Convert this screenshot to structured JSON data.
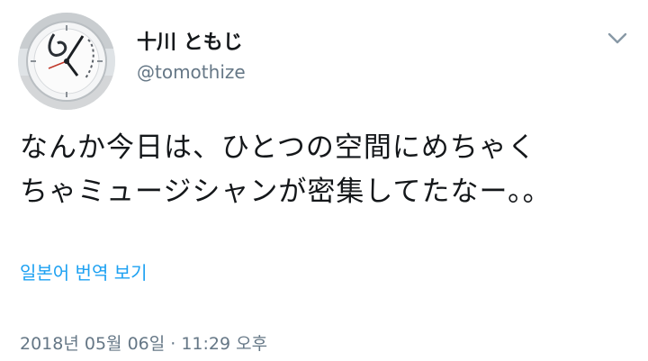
{
  "author": {
    "display_name": "十川 ともじ",
    "handle": "@tomothize",
    "avatar_icon": "clock-avatar-icon"
  },
  "tweet": {
    "text_lines": [
      "なんか今日は、ひとつの空間にめちゃく",
      "ちゃミュージシャンが密集してたなー。。"
    ],
    "translate_label": "일본어 번역 보기",
    "timestamp": "2018년 05월 06일 · 11:29 오후"
  },
  "menu": {
    "caret_icon": "chevron-down-icon"
  },
  "colors": {
    "link": "#1da1f2",
    "secondary_text": "#657786",
    "primary_text": "#14171a"
  }
}
